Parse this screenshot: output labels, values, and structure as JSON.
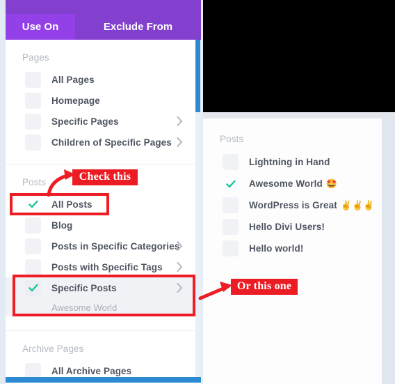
{
  "window": {
    "tabs": [
      {
        "id": "use-on",
        "label": "Use On",
        "active": true
      },
      {
        "id": "exclude-from",
        "label": "Exclude From",
        "active": false
      }
    ]
  },
  "left_panel": {
    "groups": [
      {
        "id": "pages",
        "title": "Pages",
        "items": [
          {
            "label": "All Pages",
            "checked": false,
            "chevron": false
          },
          {
            "label": "Homepage",
            "checked": false,
            "chevron": false
          },
          {
            "label": "Specific Pages",
            "checked": false,
            "chevron": true
          },
          {
            "label": "Children of Specific Pages",
            "checked": false,
            "chevron": true
          }
        ]
      },
      {
        "id": "posts",
        "title": "Posts",
        "items": [
          {
            "label": "All Posts",
            "checked": true,
            "chevron": false
          },
          {
            "label": "Blog",
            "checked": false,
            "chevron": false
          },
          {
            "label": "Posts in Specific Categories",
            "checked": false,
            "chevron": true
          },
          {
            "label": "Posts with Specific Tags",
            "checked": false,
            "chevron": true
          },
          {
            "label": "Specific Posts",
            "checked": true,
            "chevron": true,
            "selected": true,
            "subtext": "Awesome World"
          }
        ]
      },
      {
        "id": "archive-pages",
        "title": "Archive Pages",
        "items": [
          {
            "label": "All Archive Pages",
            "checked": false,
            "chevron": false
          }
        ]
      }
    ]
  },
  "right_panel": {
    "group_title": "Posts",
    "items": [
      {
        "label": "Lightning in Hand",
        "emoji": "",
        "checked": false
      },
      {
        "label": "Awesome World",
        "emoji": "🤩",
        "checked": true
      },
      {
        "label": "WordPress is Great",
        "emoji": "✌️✌️✌️",
        "checked": false
      },
      {
        "label": "Hello Divi Users!",
        "emoji": "",
        "checked": false
      },
      {
        "label": "Hello world!",
        "emoji": "",
        "checked": false
      }
    ]
  },
  "annotations": [
    {
      "id": "check-this",
      "label": "Check this"
    },
    {
      "id": "or-this-one",
      "label": "Or this one"
    }
  ],
  "colors": {
    "tab_bar": "#8340cf",
    "tab_active": "#9440e8",
    "checkmark": "#0fc4a0",
    "annotation_red": "#ee1c25",
    "scrollbar_blue": "#2b8ad1"
  }
}
